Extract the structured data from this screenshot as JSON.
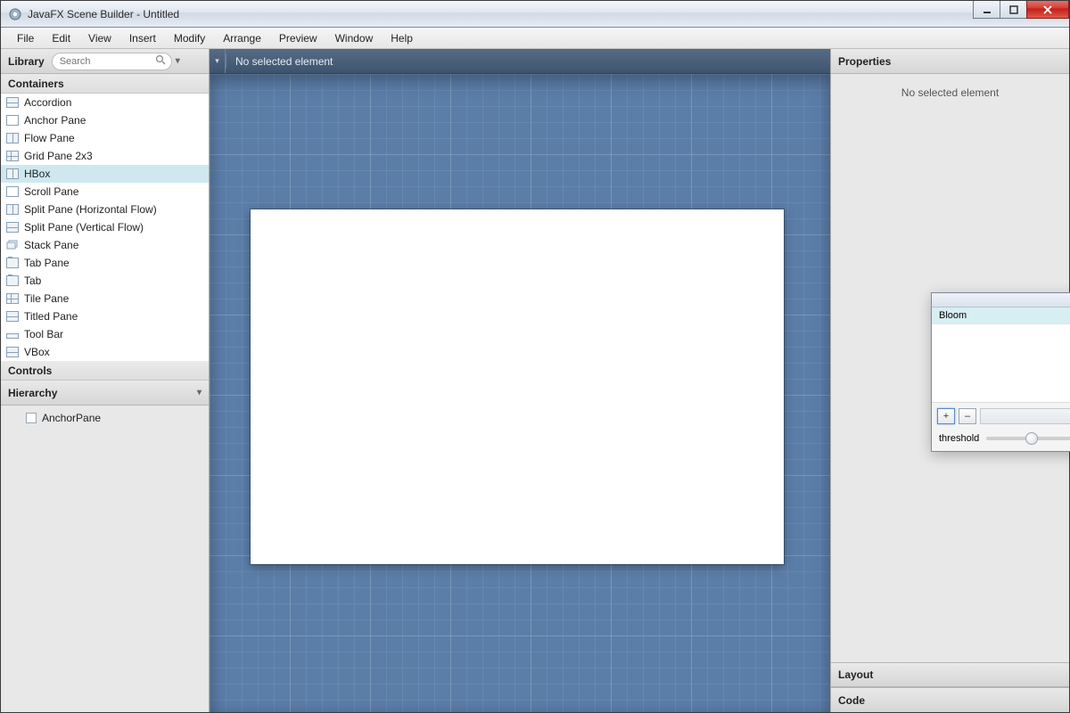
{
  "window": {
    "title": "JavaFX Scene Builder - Untitled"
  },
  "menu": {
    "items": [
      "File",
      "Edit",
      "View",
      "Insert",
      "Modify",
      "Arrange",
      "Preview",
      "Window",
      "Help"
    ]
  },
  "left": {
    "library_label": "Library",
    "search_placeholder": "Search",
    "sections": {
      "containers_label": "Containers",
      "controls_label": "Controls"
    },
    "containers": [
      {
        "label": "Accordion",
        "icon": "vsplit"
      },
      {
        "label": "Anchor Pane",
        "icon": "empty"
      },
      {
        "label": "Flow Pane",
        "icon": "hsplit"
      },
      {
        "label": "Grid Pane 2x3",
        "icon": "grid"
      },
      {
        "label": "HBox",
        "icon": "hsplit",
        "selected": true
      },
      {
        "label": "Scroll Pane",
        "icon": "empty"
      },
      {
        "label": "Split Pane (Horizontal Flow)",
        "icon": "hsplit"
      },
      {
        "label": "Split Pane (Vertical Flow)",
        "icon": "vsplit"
      },
      {
        "label": "Stack Pane",
        "icon": "stack"
      },
      {
        "label": "Tab Pane",
        "icon": "tab"
      },
      {
        "label": "Tab",
        "icon": "tab"
      },
      {
        "label": "Tile Pane",
        "icon": "grid"
      },
      {
        "label": "Titled Pane",
        "icon": "vsplit"
      },
      {
        "label": "Tool Bar",
        "icon": "toolbar"
      },
      {
        "label": "VBox",
        "icon": "vsplit"
      }
    ],
    "hierarchy_label": "Hierarchy",
    "hierarchy_root": "AnchorPane"
  },
  "center": {
    "selection_text": "No selected element"
  },
  "right": {
    "properties_label": "Properties",
    "properties_empty": "No selected element",
    "layout_label": "Layout",
    "code_label": "Code"
  },
  "popup": {
    "item": "Bloom",
    "add": "+",
    "remove": "–",
    "slider_label": "threshold"
  }
}
